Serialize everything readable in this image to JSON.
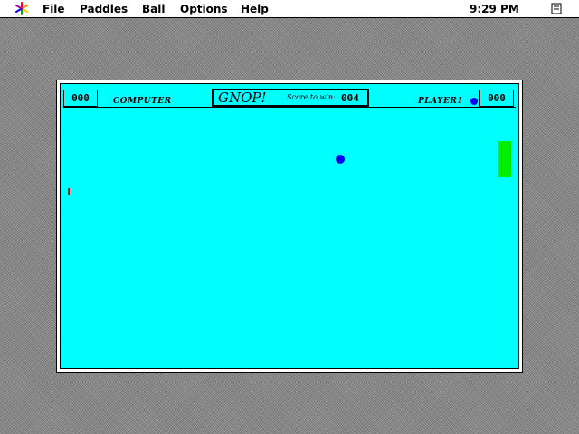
{
  "menubar": {
    "apple_icon": "apple-icon",
    "items": [
      "File",
      "Paddles",
      "Ball",
      "Options",
      "Help"
    ],
    "clock": "9:29 PM",
    "finder_icon": "finder-icon"
  },
  "game": {
    "title": "GNOP!",
    "score_to_win_label": "Score to win:",
    "score_to_win": "004",
    "left_player": {
      "name": "COMPUTER",
      "score": "000"
    },
    "right_player": {
      "name": "PLAYER1",
      "score": "000"
    },
    "colors": {
      "field": "#00ffff",
      "ball": "#0000ff",
      "player_paddle": "#00ee00",
      "computer_paddle": "#cc0000"
    }
  }
}
